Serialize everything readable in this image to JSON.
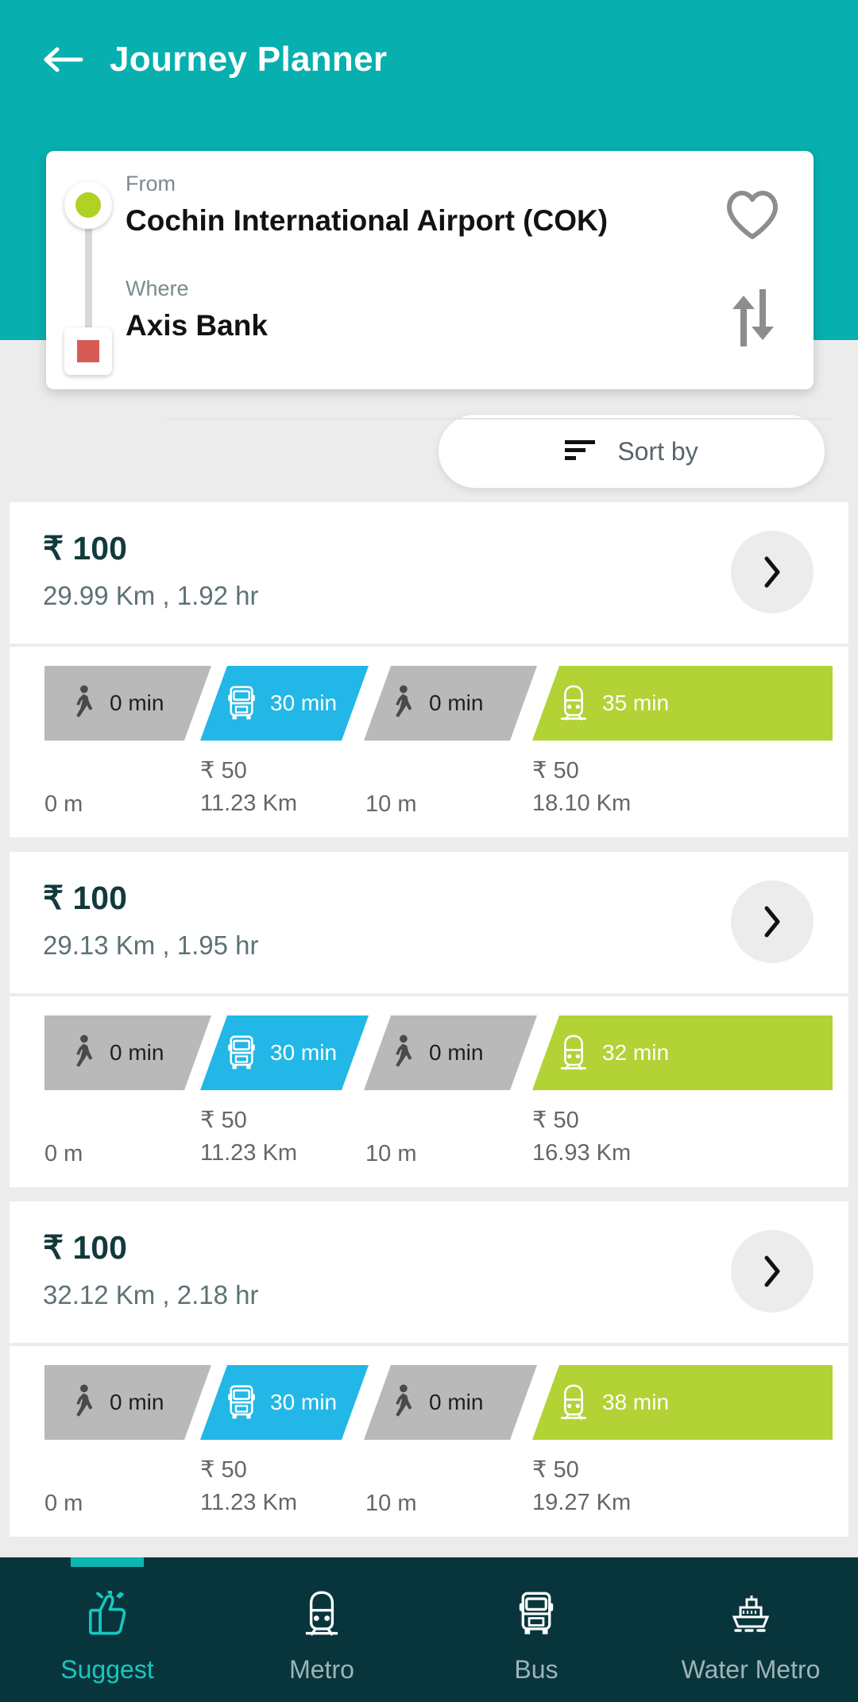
{
  "header": {
    "title": "Journey Planner",
    "back_icon": "arrow-left-icon",
    "bg_color": "#07b0ae"
  },
  "search": {
    "from_label": "From",
    "from_value": "Cochin International Airport (COK)",
    "where_label": "Where",
    "where_value": "Axis Bank",
    "favorite_icon": "heart-icon",
    "swap_icon": "swap-vertical-icon",
    "origin_marker_color": "#afd224",
    "destination_marker_color": "#d75a55"
  },
  "sort": {
    "label": "Sort by",
    "icon": "sort-lines-icon"
  },
  "colors": {
    "walk": "#b9b9b9",
    "bus": "#22b7e6",
    "metro": "#b2d236",
    "accent": "#07b0ae",
    "nav_bg": "#08353c",
    "nav_active": "#19c7bf"
  },
  "results": [
    {
      "price": "₹ 100",
      "meta": "29.99 Km , 1.92 hr",
      "chevron_icon": "chevron-right-icon",
      "legs": [
        {
          "mode": "walk",
          "icon": "walk-icon",
          "time": "0 min",
          "fare": "",
          "distance": "0 m"
        },
        {
          "mode": "bus",
          "icon": "bus-icon",
          "time": "30 min",
          "fare": "₹ 50",
          "distance": "11.23 Km"
        },
        {
          "mode": "walk",
          "icon": "walk-icon",
          "time": "0 min",
          "fare": "",
          "distance": "10 m"
        },
        {
          "mode": "metro",
          "icon": "train-icon",
          "time": "35 min",
          "fare": "₹ 50",
          "distance": "18.10 Km"
        }
      ]
    },
    {
      "price": "₹ 100",
      "meta": "29.13 Km , 1.95 hr",
      "chevron_icon": "chevron-right-icon",
      "legs": [
        {
          "mode": "walk",
          "icon": "walk-icon",
          "time": "0 min",
          "fare": "",
          "distance": "0 m"
        },
        {
          "mode": "bus",
          "icon": "bus-icon",
          "time": "30 min",
          "fare": "₹ 50",
          "distance": "11.23 Km"
        },
        {
          "mode": "walk",
          "icon": "walk-icon",
          "time": "0 min",
          "fare": "",
          "distance": "10 m"
        },
        {
          "mode": "metro",
          "icon": "train-icon",
          "time": "32 min",
          "fare": "₹ 50",
          "distance": "16.93 Km"
        }
      ]
    },
    {
      "price": "₹ 100",
      "meta": "32.12 Km , 2.18 hr",
      "chevron_icon": "chevron-right-icon",
      "legs": [
        {
          "mode": "walk",
          "icon": "walk-icon",
          "time": "0 min",
          "fare": "",
          "distance": "0 m"
        },
        {
          "mode": "bus",
          "icon": "bus-icon",
          "time": "30 min",
          "fare": "₹ 50",
          "distance": "11.23 Km"
        },
        {
          "mode": "walk",
          "icon": "walk-icon",
          "time": "0 min",
          "fare": "",
          "distance": "10 m"
        },
        {
          "mode": "metro",
          "icon": "train-icon",
          "time": "38 min",
          "fare": "₹ 50",
          "distance": "19.27 Km"
        }
      ]
    }
  ],
  "bottom_nav": {
    "items": [
      {
        "label": "Suggest",
        "icon": "thumbs-up-icon",
        "active": true
      },
      {
        "label": "Metro",
        "icon": "train-icon",
        "active": false
      },
      {
        "label": "Bus",
        "icon": "bus-icon",
        "active": false
      },
      {
        "label": "Water Metro",
        "icon": "ferry-boat-icon",
        "active": false
      }
    ]
  }
}
